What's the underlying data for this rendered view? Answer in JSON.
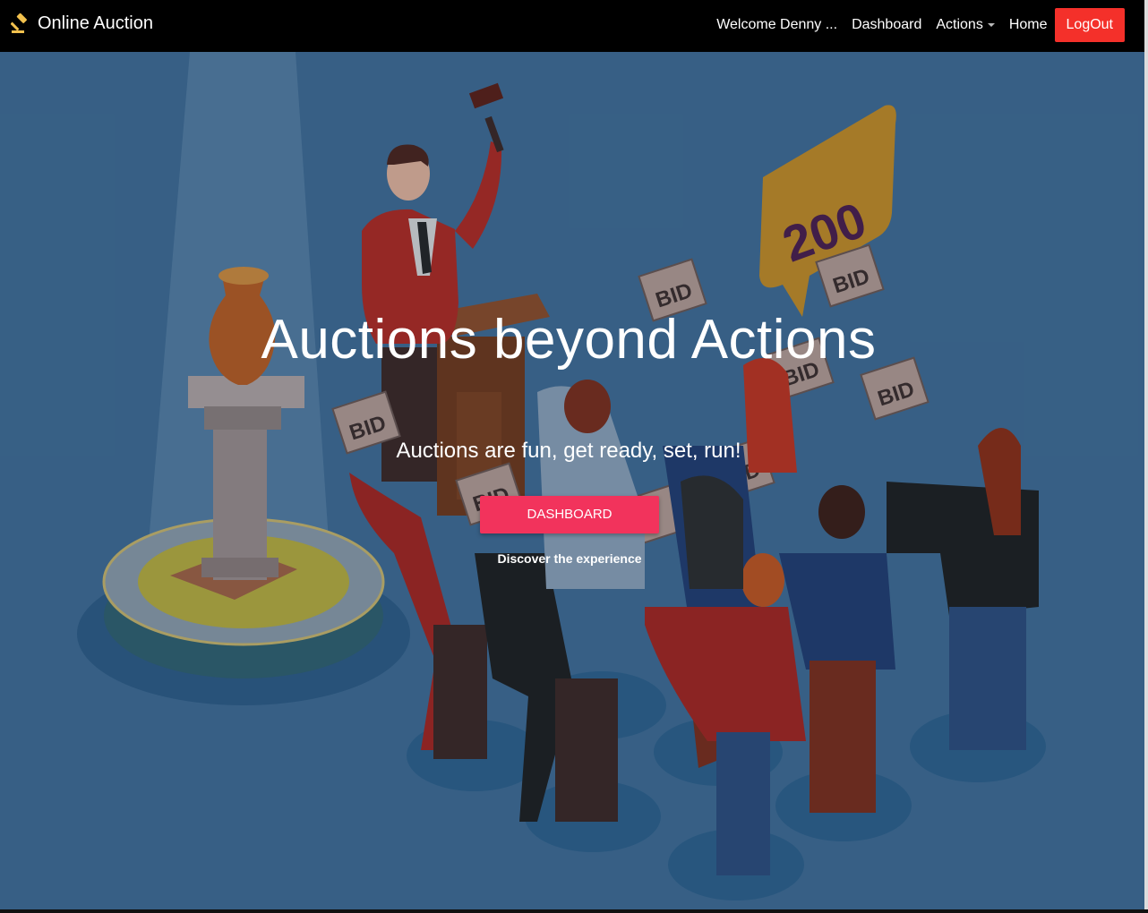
{
  "brand": {
    "title": "Online Auction",
    "icon": "gavel-icon"
  },
  "nav": {
    "welcome": "Welcome Denny ...",
    "dashboard": "Dashboard",
    "actions": "Actions",
    "home": "Home",
    "logout": "LogOut"
  },
  "hero": {
    "title": "Auctions beyond Actions",
    "subtitle": "Auctions are fun, get ready, set, run!",
    "cta_label": "DASHBOARD",
    "cta_caption": "Discover the experience",
    "bubble_text": "200",
    "bid_label": "BID"
  },
  "colors": {
    "navbar": "#000000",
    "logout_bg": "#f4302a",
    "cta_bg": "#f2335c",
    "hero_bg": "#3d6a93",
    "brand_icon": "#f2c14e"
  }
}
